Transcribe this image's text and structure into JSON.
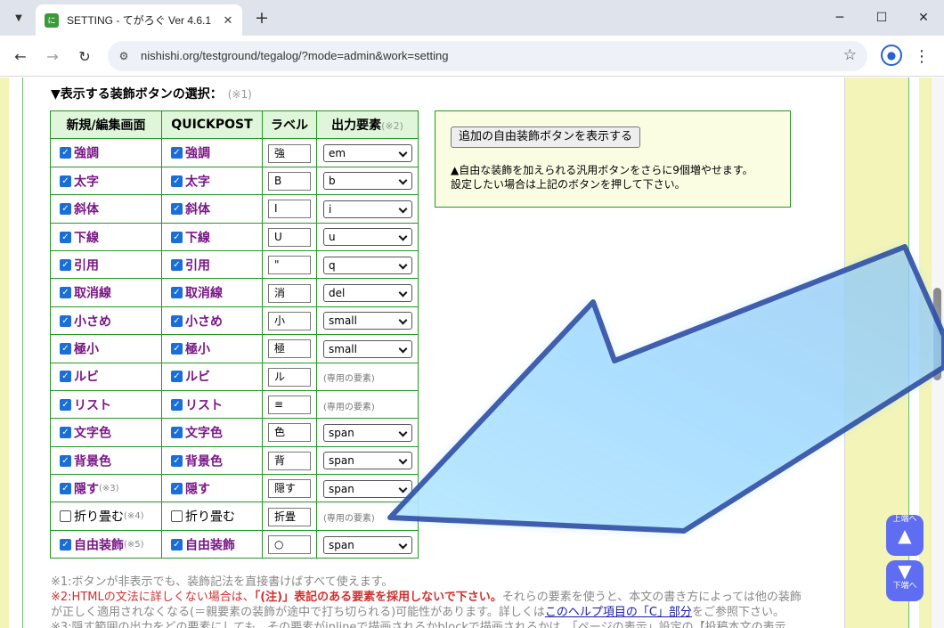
{
  "browser": {
    "tab_title": "SETTING - てがろぐ Ver 4.6.1",
    "favicon_glyph": "に",
    "url": "nishishi.org/testground/tegalog/?mode=admin&work=setting"
  },
  "section": {
    "title": "▼表示する装飾ボタンの選択：",
    "note": "(※1)"
  },
  "table": {
    "headers": {
      "edit": "新規/編集画面",
      "quick": "QUICKPOST",
      "label": "ラベル",
      "output": "出力要素",
      "output_note": "(※2)"
    },
    "rows": [
      {
        "name": "強調",
        "label": "強",
        "output": "em",
        "edit_checked": true,
        "quick_checked": true
      },
      {
        "name": "太字",
        "label": "B",
        "output": "b",
        "edit_checked": true,
        "quick_checked": true
      },
      {
        "name": "斜体",
        "label": "I",
        "output": "i",
        "edit_checked": true,
        "quick_checked": true
      },
      {
        "name": "下線",
        "label": "U",
        "output": "u",
        "edit_checked": true,
        "quick_checked": true
      },
      {
        "name": "引用",
        "label": "\"",
        "output": "q",
        "edit_checked": true,
        "quick_checked": true
      },
      {
        "name": "取消線",
        "label": "消",
        "output": "del",
        "edit_checked": true,
        "quick_checked": true
      },
      {
        "name": "小さめ",
        "label": "小",
        "output": "small",
        "edit_checked": true,
        "quick_checked": true
      },
      {
        "name": "極小",
        "label": "極",
        "output": "small",
        "edit_checked": true,
        "quick_checked": true
      },
      {
        "name": "ルビ",
        "label": "ル",
        "output": "(専用の要素)",
        "edit_checked": true,
        "quick_checked": true
      },
      {
        "name": "リスト",
        "label": "≡",
        "output": "(専用の要素)",
        "edit_checked": true,
        "quick_checked": true
      },
      {
        "name": "文字色",
        "label": "色",
        "output": "span",
        "edit_checked": true,
        "quick_checked": true
      },
      {
        "name": "背景色",
        "label": "背",
        "output": "span",
        "edit_checked": true,
        "quick_checked": true
      },
      {
        "name": "隠す",
        "name_note": "(※3)",
        "label": "隠す",
        "output": "span",
        "edit_checked": true,
        "quick_checked": true
      },
      {
        "name": "折り畳む",
        "name_note": "(※4)",
        "label": "折畳",
        "output": "(専用の要素)",
        "edit_checked": false,
        "quick_checked": false
      },
      {
        "name": "自由装飾",
        "name_note": "(※5)",
        "label": "○",
        "output": "span",
        "edit_checked": true,
        "quick_checked": true
      }
    ]
  },
  "side": {
    "button": "追加の自由装飾ボタンを表示する",
    "text1": "▲自由な装飾を加えられる汎用ボタンをさらに9個増やせます。",
    "text2": "設定したい場合は上記のボタンを押して下さい。"
  },
  "notes": {
    "n1": "※1:ボタンが非表示でも、装飾記法を直接書けばすべて使えます。",
    "n2a": "※2:HTMLの文法に詳しくない場合は、",
    "n2b": "「(注)」表記のある要素を採用しないで下さい。",
    "n2c": "それらの要素を使うと、本文の書き方によっては他の装飾",
    "n2d": "が正しく適用されなくなる(＝親要素の装飾が途中で打ち切られる)可能性があります。詳しくは",
    "n2link": "このヘルプ項目の「C」部分",
    "n2e": "をご参照下さい。",
    "n3": "※3:隠す範囲の出力をどの要素にしても、その要素がinlineで描画されるかblockで描画されるかは、「ページの表示」設定の【投稿本文の表示"
  },
  "jump": {
    "top_label": "上端へ",
    "bottom_label": "下端へ"
  },
  "colors": {
    "accent_purple": "#7a1787",
    "table_border": "#229922",
    "header_bg": "#dff6da",
    "warning_red": "#d03030",
    "jump_button": "#5e6df2"
  }
}
